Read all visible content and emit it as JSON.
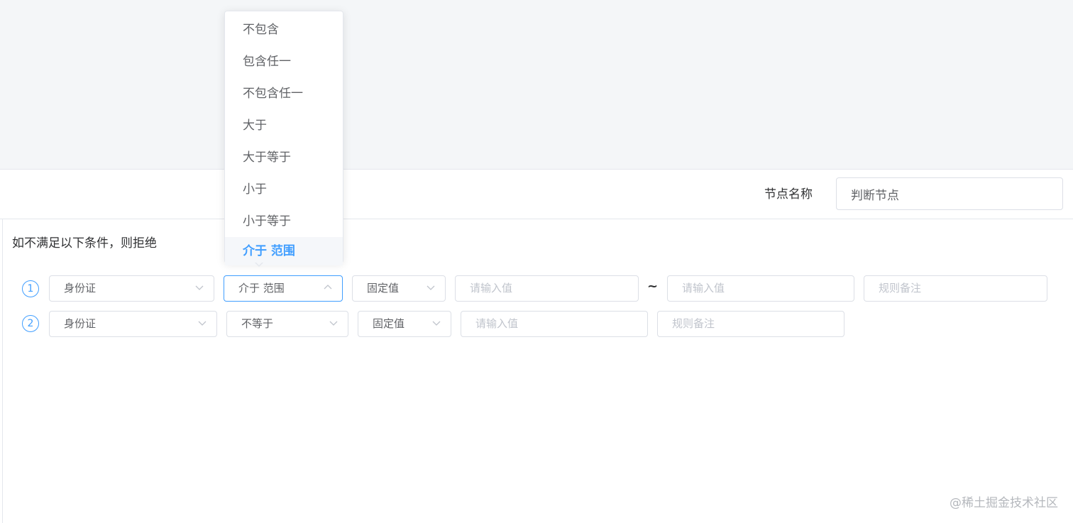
{
  "node": {
    "label": "节点名称",
    "value": "判断节点"
  },
  "condition": {
    "reject_text": "如不满足以下条件，则拒绝"
  },
  "rows": [
    {
      "index": "1",
      "field": "身份证",
      "operator": "介于 范围",
      "value_type": "固定值",
      "value_placeholder": "请输入值",
      "separator": "~",
      "value2_placeholder": "请输入值",
      "remark_placeholder": "规则备注"
    },
    {
      "index": "2",
      "field": "身份证",
      "operator": "不等于",
      "value_type": "固定值",
      "value_placeholder": "请输入值",
      "remark_placeholder": "规则备注"
    }
  ],
  "operator_dropdown": {
    "options": [
      "不包含",
      "包含任一",
      "不包含任一",
      "大于",
      "大于等于",
      "小于",
      "小于等于",
      "介于 范围"
    ],
    "selected": "介于 范围"
  },
  "watermark": "@稀土掘金技术社区",
  "colors": {
    "accent": "#409eff",
    "canvas_bg": "#f4f6f8",
    "border": "#dcdfe6",
    "placeholder": "#c0c4cc"
  },
  "icons": {
    "select_closed": "chevron-down-icon",
    "select_open": "chevron-up-icon"
  }
}
